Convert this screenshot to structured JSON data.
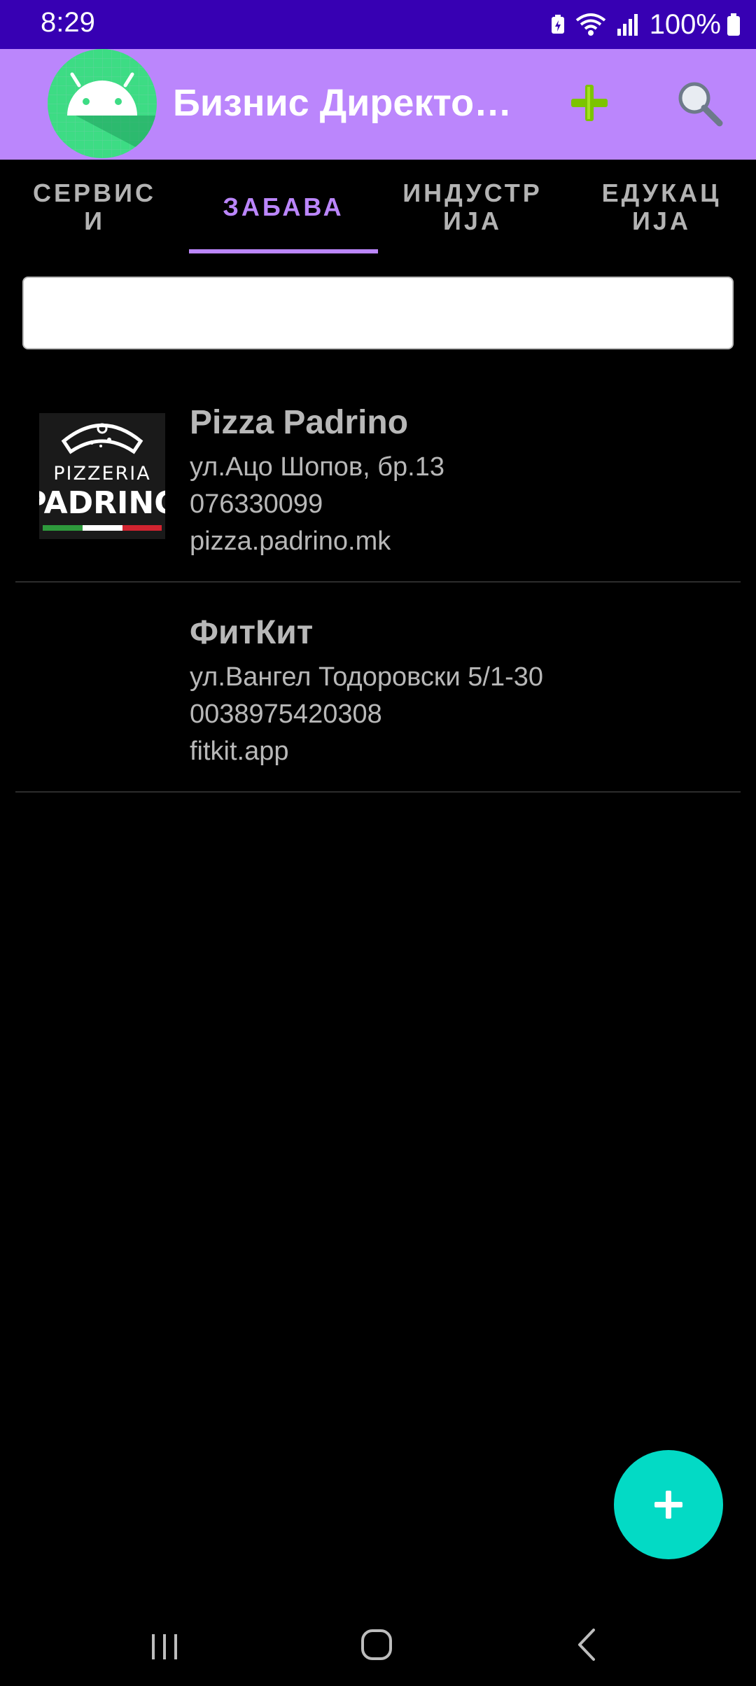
{
  "status_bar": {
    "time": "8:29",
    "battery_percent": "100%",
    "icons": [
      "battery-saver-icon",
      "wifi-icon",
      "signal-icon",
      "battery-icon"
    ]
  },
  "app_bar": {
    "title": "Бизнис Директориум",
    "logo_icon": "android-logo-icon",
    "actions": [
      "add-icon",
      "search-icon"
    ],
    "colors": {
      "background": "#bb86fc",
      "add_icon": "#7cc400"
    }
  },
  "tabs": [
    {
      "label": "СЕРВИСИ",
      "active": false
    },
    {
      "label": "ЗАБАВА",
      "active": true
    },
    {
      "label": "ИНДУСТРИЈА",
      "active": false
    },
    {
      "label": "ЕДУКАЦИЈА",
      "active": false
    }
  ],
  "search": {
    "value": "",
    "placeholder": ""
  },
  "businesses": [
    {
      "name": "Pizza Padrino",
      "address": "ул.Ацо Шопов, бр.13",
      "phone": "076330099",
      "website": "pizza.padrino.mk",
      "logo": {
        "line1": "PIZZERIA",
        "line2": "PADRINO"
      }
    },
    {
      "name": "ФитКит",
      "address": "ул.Вангел Тодоровски 5/1-30",
      "phone": "0038975420308",
      "website": "fitkit.app",
      "logo": null
    }
  ],
  "fab": {
    "icon": "plus-icon",
    "color": "#03dac5"
  },
  "nav_bar": {
    "buttons": [
      "recent-apps-icon",
      "home-icon",
      "back-icon"
    ]
  }
}
